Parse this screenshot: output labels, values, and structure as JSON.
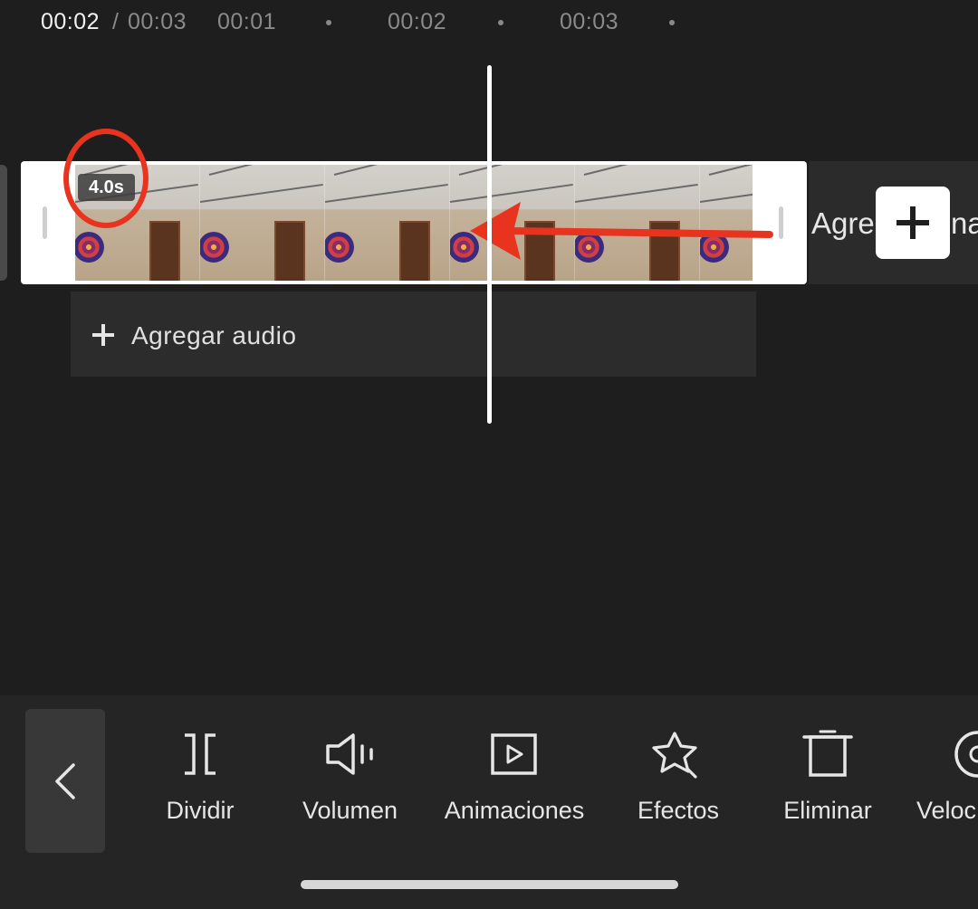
{
  "timeline": {
    "current_time": "00:02",
    "separator": "/",
    "total_time": "00:03",
    "ticks": [
      "00:01",
      "00:02",
      "00:03"
    ]
  },
  "clip": {
    "duration_badge": "4.0s"
  },
  "add_clip": {
    "label_visible_start": "Agre",
    "label_visible_end": "na"
  },
  "audio": {
    "label": "Agregar audio"
  },
  "toolbar": {
    "items": [
      {
        "label": "Dividir",
        "icon": "split-icon"
      },
      {
        "label": "Volumen",
        "icon": "volume-icon"
      },
      {
        "label": "Animaciones",
        "icon": "animation-play-icon"
      },
      {
        "label": "Efectos",
        "icon": "effects-star-icon"
      },
      {
        "label": "Eliminar",
        "icon": "delete-icon"
      },
      {
        "label": "Veloc",
        "icon": "speed-icon"
      }
    ]
  },
  "colors": {
    "background": "#1e1e1e",
    "toolbar": "#252525",
    "annotation_red": "#e8341f"
  }
}
